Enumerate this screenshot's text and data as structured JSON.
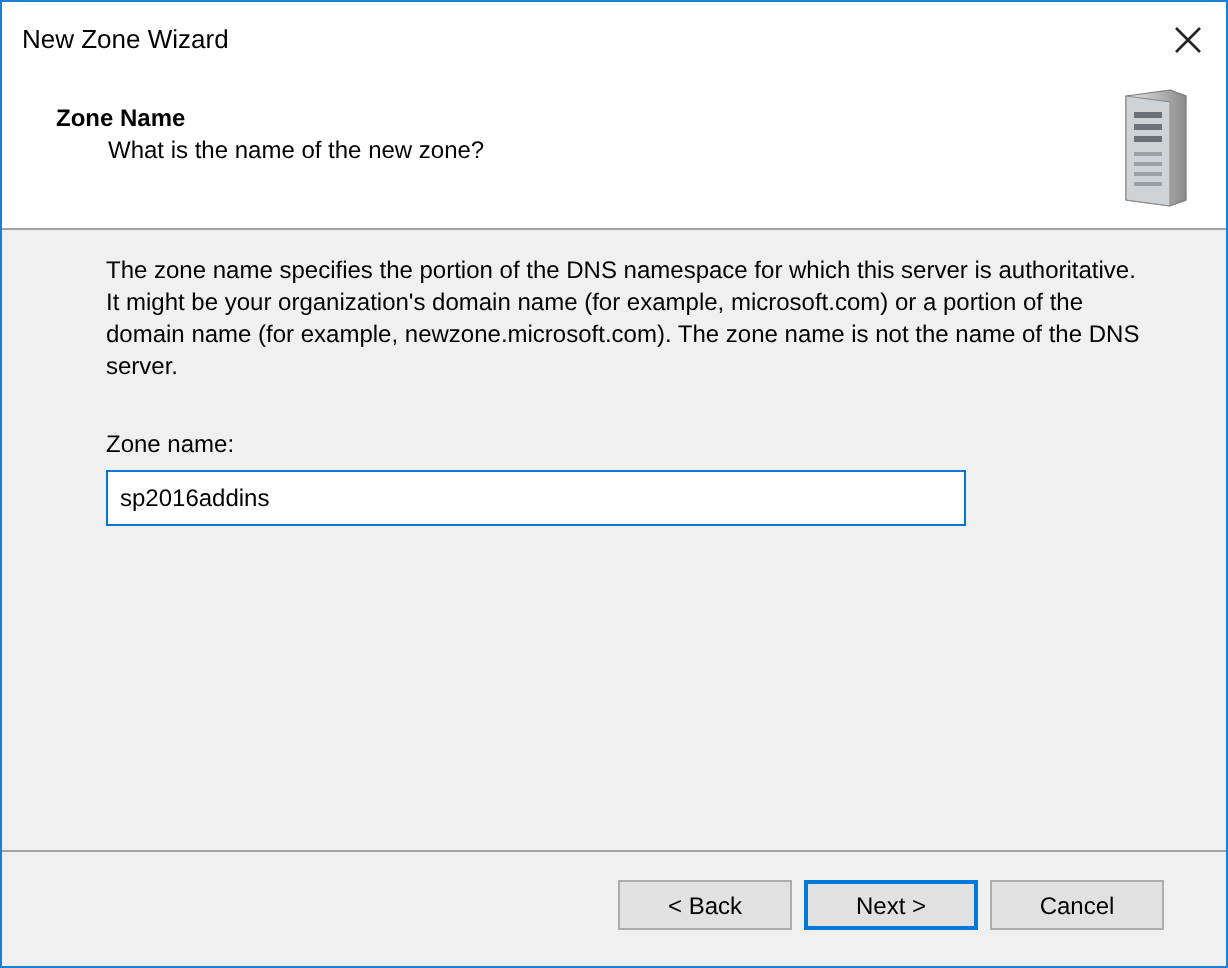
{
  "window": {
    "title": "New Zone Wizard"
  },
  "header": {
    "title": "Zone Name",
    "subtitle": "What is the name of the new zone?"
  },
  "description": "The zone name specifies the portion of the DNS namespace for which this server is authoritative. It might be your organization's domain name (for example,  microsoft.com) or a portion of the domain name (for example, newzone.microsoft.com). The zone name is not the name of the DNS server.",
  "zone_name_field": {
    "label": "Zone name:",
    "value": "sp2016addins"
  },
  "buttons": [
    {
      "label": "< Back",
      "default": false
    },
    {
      "label": "Next >",
      "default": true
    },
    {
      "label": "Cancel",
      "default": false
    }
  ]
}
